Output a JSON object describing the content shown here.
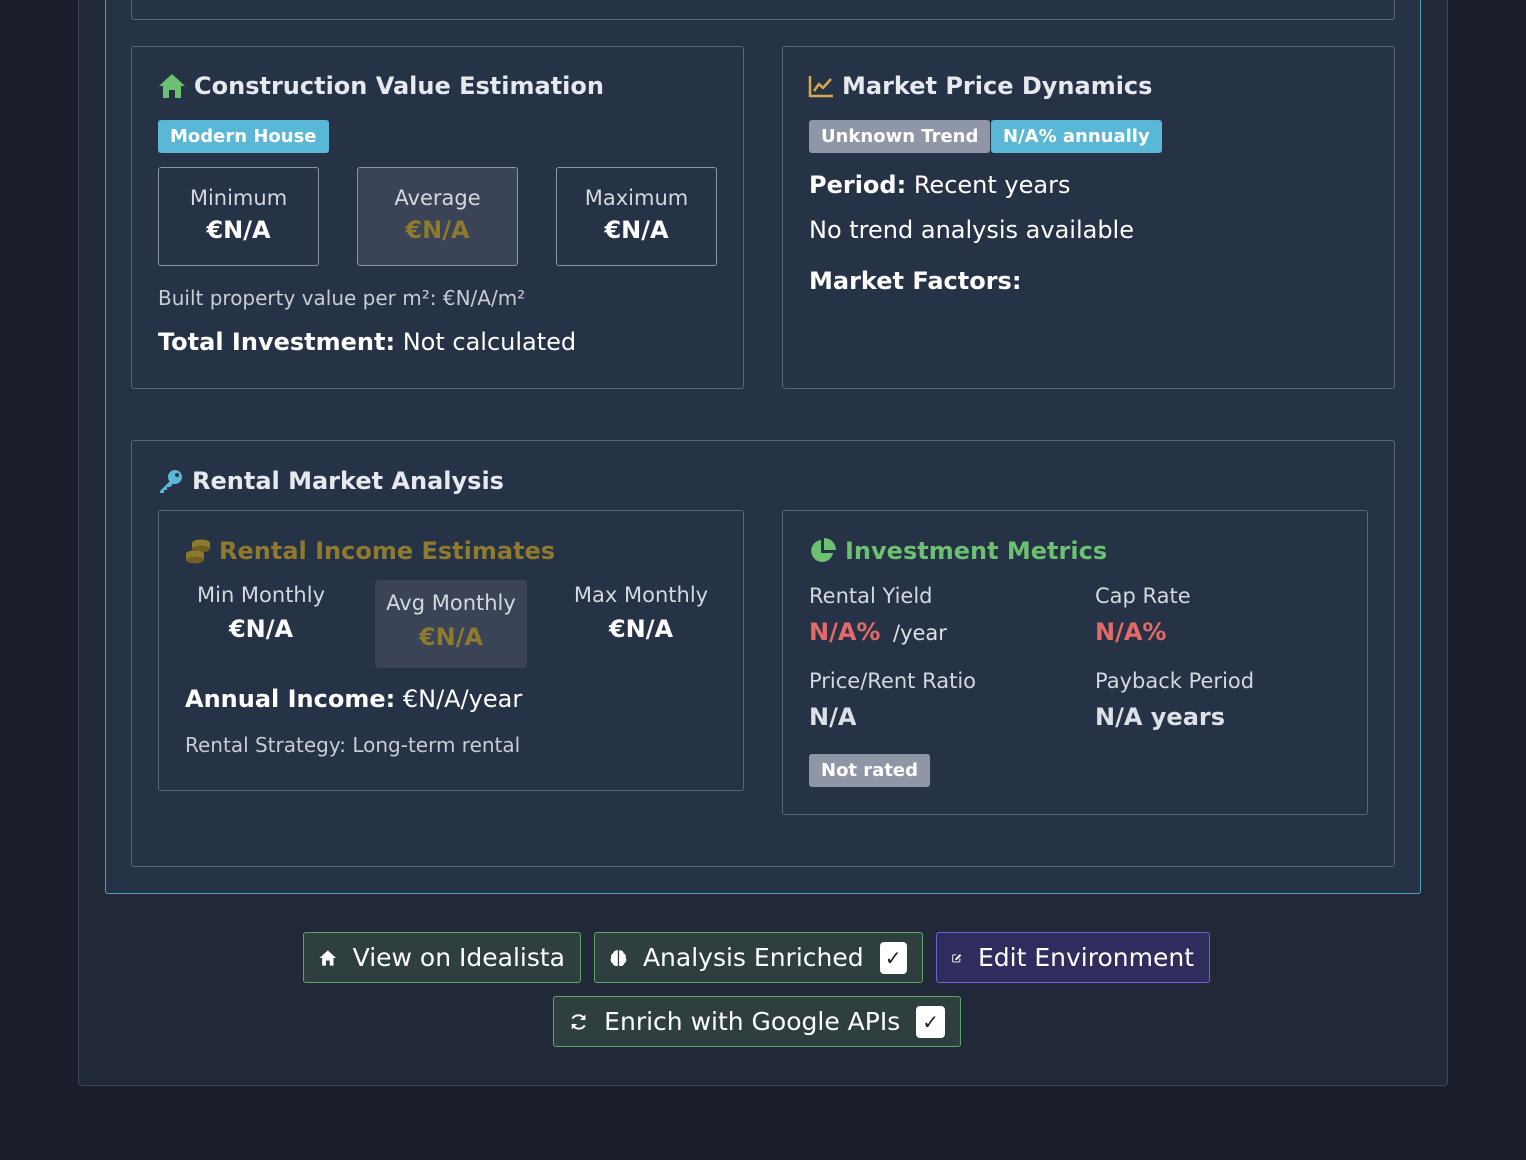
{
  "construction": {
    "title": "Construction Value Estimation",
    "badge": "Modern House",
    "values": [
      {
        "label": "Minimum",
        "value": "€N/A"
      },
      {
        "label": "Average",
        "value": "€N/A"
      },
      {
        "label": "Maximum",
        "value": "€N/A"
      }
    ],
    "per_m2": "Built property value per m²: €N/A/m²",
    "total_label": "Total Investment:",
    "total_value": " Not calculated"
  },
  "market": {
    "title": "Market Price Dynamics",
    "trend_badge": "Unknown Trend",
    "annual_badge": "N/A% annually",
    "period_label": "Period:",
    "period_value": " Recent years",
    "analysis": "No trend analysis available",
    "factors_label": "Market Factors:"
  },
  "rental": {
    "title": "Rental Market Analysis",
    "income": {
      "title": "Rental Income Estimates",
      "columns": [
        {
          "label": "Min Monthly",
          "value": "€N/A"
        },
        {
          "label": "Avg Monthly",
          "value": "€N/A"
        },
        {
          "label": "Max Monthly",
          "value": "€N/A"
        }
      ],
      "annual_label": "Annual Income:",
      "annual_value": " €N/A/year",
      "strategy": "Rental Strategy: Long-term rental"
    },
    "metrics": {
      "title": "Investment Metrics",
      "rental_yield_label": "Rental Yield",
      "rental_yield_value": "N/A%",
      "rental_yield_unit": "/year",
      "cap_rate_label": "Cap Rate",
      "cap_rate_value": "N/A%",
      "price_rent_label": "Price/Rent Ratio",
      "price_rent_value": "N/A",
      "payback_label": "Payback Period",
      "payback_value": "N/A years",
      "rating_badge": "Not rated"
    }
  },
  "actions": {
    "view_idealista": "View on Idealista",
    "analysis_enriched": "Analysis Enriched",
    "analysis_check": "✓",
    "edit_environment": "Edit Environment",
    "enrich_google": "Enrich with Google APIs",
    "enrich_check": "✓"
  },
  "colors": {
    "accent_info": "#5bb7d6",
    "green_icon": "#6cc070",
    "gold": "#8e7a2e",
    "danger": "#e46a6a",
    "purple": "#6c61d9"
  },
  "icons": [
    "home-icon",
    "chart-line-icon",
    "key-icon",
    "coins-icon",
    "pie-chart-icon",
    "brain-icon",
    "edit-icon",
    "sync-icon"
  ]
}
